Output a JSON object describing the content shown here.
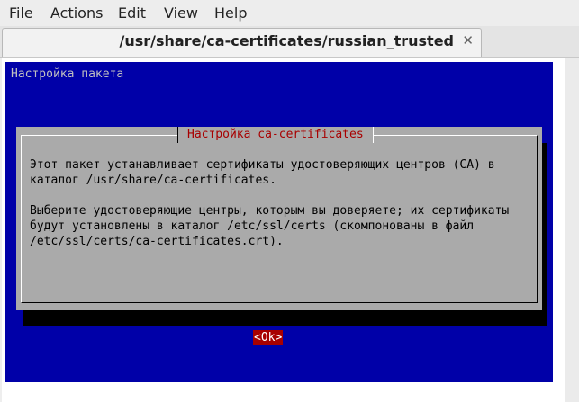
{
  "menu": {
    "file": "File",
    "actions": "Actions",
    "edit": "Edit",
    "view": "View",
    "help": "Help"
  },
  "tab": {
    "title": "/usr/share/ca-certificates/russian_trusted",
    "close_glyph": "✕"
  },
  "terminal": {
    "backtitle": "Настройка пакета",
    "dialog": {
      "title": "Настройка ca-certificates",
      "lines": [
        "Этот пакет устанавливает сертификаты удостоверяющих центров (CA) в",
        "каталог /usr/share/ca-certificates.",
        "",
        "Выберите удостоверяющие центры, которым вы доверяете; их сертификаты",
        "будут установлены в каталог /etc/ssl/certs (скомпонованы в файл",
        "/etc/ssl/certs/ca-certificates.crt)."
      ],
      "ok_button": "<Ok>"
    },
    "colors": {
      "background": "#0000a8",
      "dialog": "#aaaaaa",
      "title_text": "#a80000",
      "button": "#a80000"
    }
  }
}
